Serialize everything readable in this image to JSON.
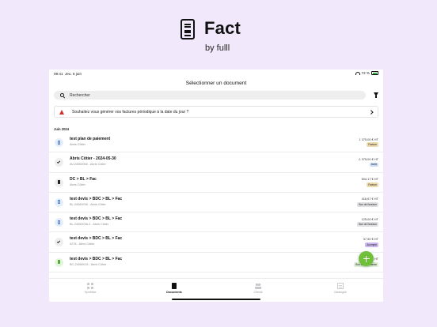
{
  "brand": {
    "name": "Fact",
    "subtitle": "by fulll"
  },
  "status_bar": {
    "time": "09:41",
    "date": "Jeu. 6 juin",
    "battery": "72 %"
  },
  "nav": {
    "title": "Sélectionner un document"
  },
  "search": {
    "placeholder": "Rechercher"
  },
  "banner": {
    "text": "Souhaitez vous générer vos factures périodique à la date du jour ?"
  },
  "section": {
    "title": "Juin 2024"
  },
  "documents": [
    {
      "kind": "facture",
      "icon": "file-icon",
      "title": "test plan de paiement",
      "sub": "Abris Côtier",
      "amount": "1 375,00 € HT",
      "badge": "Facture",
      "badge_style": "badge-facture"
    },
    {
      "kind": "avoir",
      "icon": "check-icon",
      "title": "Abris Côtier - 2024-05-30",
      "sub": "AV-24060066 - Abris Côtier",
      "amount": "-1 375,00 € HT",
      "badge": "Avoir",
      "badge_style": "badge-avoir"
    },
    {
      "kind": "dark",
      "icon": "file-icon",
      "title": "DC > BL > Fac",
      "sub": "Abris Côtier",
      "amount": "504,17 € HT",
      "badge": "Facture",
      "badge_style": "badge-facture"
    },
    {
      "kind": "bl",
      "icon": "file-icon",
      "title": "test devis > BDC > BL > Fac",
      "sub": "BL-24060036 - Abris Côtier",
      "amount": "416,67 € HT",
      "badge": "Bon de livraison",
      "badge_style": "badge-livraison"
    },
    {
      "kind": "bl",
      "icon": "file-icon",
      "title": "test devis > BDC > BL > Fac",
      "sub": "BL-24060036-2 - Abris Côtier",
      "amount": "125,00 € HT",
      "badge": "Bon de livraison",
      "badge_style": "badge-livraison"
    },
    {
      "kind": "avoir",
      "icon": "check-icon",
      "title": "test devis > BDC > BL > Fac",
      "sub": "0278 - Abris Côtier",
      "amount": "37,50 € HT",
      "badge": "Acompte",
      "badge_style": "badge-acompte"
    },
    {
      "kind": "bdc",
      "icon": "file-icon",
      "title": "test devis > BDC > BL > Fac",
      "sub": "BC-24060015 - Abris Côtier",
      "amount": "HT",
      "badge": "Bon de commande",
      "badge_style": "badge-commande"
    }
  ],
  "tabs": [
    {
      "label": "Synthèse",
      "icon": "grid-icon",
      "active": false
    },
    {
      "label": "Documents",
      "icon": "document-icon",
      "active": true
    },
    {
      "label": "Clients",
      "icon": "people-icon",
      "active": false
    },
    {
      "label": "Catalogue",
      "icon": "catalog-icon",
      "active": false
    }
  ],
  "colors": {
    "background": "#f1e9fb",
    "accent": "#6fbf3a",
    "warning": "#d0302a"
  }
}
